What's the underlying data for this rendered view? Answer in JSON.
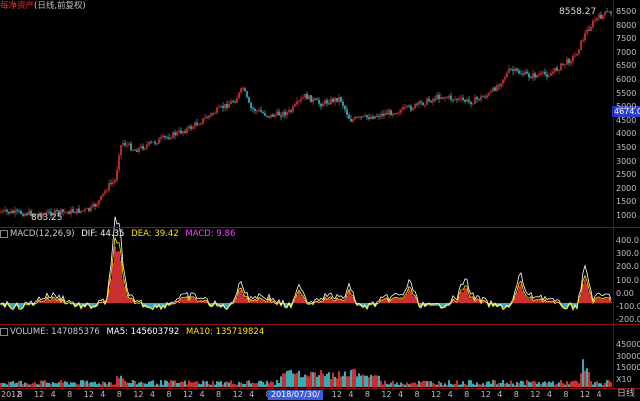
{
  "header": {
    "title": "每净资产",
    "mode": "(日线,前复权)"
  },
  "colors": {
    "up": "#ff3b3b",
    "down": "#46d6e0",
    "dif": "#ffffff",
    "dea": "#ffe400",
    "macd": "#ff3cff",
    "vol_ma5": "#ffffff",
    "vol_ma10": "#ffe400",
    "separator": "#8b1010",
    "axis_text": "#bfbfbf"
  },
  "price_panel": {
    "max_label": "8558.27",
    "min_label": "863.25",
    "current_tag": "4674.0",
    "y_labels": [
      "8500",
      "8000",
      "7500",
      "7000",
      "6500",
      "6000",
      "5500",
      "5000",
      "4500",
      "4000",
      "3500",
      "3000",
      "2500",
      "2000",
      "1500",
      "1000"
    ]
  },
  "macd_panel": {
    "name": "MACD(12,26,9)",
    "dif_label": "DIF:",
    "dif_value": "44.35",
    "dea_label": "DEA:",
    "dea_value": "39.42",
    "macd_label": "MACD:",
    "macd_value": "9.86",
    "y_labels": [
      "400.0",
      "300.0",
      "200.0",
      "100.0",
      "0.00",
      "-100.0",
      "-200.0"
    ]
  },
  "volume_panel": {
    "name": "VOLUME:",
    "vol_value": "147085376",
    "ma5_label": "MA5:",
    "ma5_value": "145603792",
    "ma10_label": "MA10:",
    "ma10_value": "135719824",
    "y_labels": [
      "45000",
      "30000",
      "15000",
      "X10"
    ]
  },
  "time_axis": {
    "labels": [
      "2012",
      "8",
      "12",
      "4",
      "8",
      "12",
      "4",
      "8",
      "12",
      "4",
      "8",
      "12",
      "4",
      "8",
      "12",
      "4",
      "8",
      "12",
      "4",
      "8",
      "12",
      "4",
      "8",
      "12",
      "4",
      "8",
      "12",
      "4",
      "8",
      "12",
      "4",
      "8",
      "12",
      "4",
      "8",
      "12",
      "4"
    ],
    "cursor_date": "2018/07/30/",
    "period": "日线"
  }
}
